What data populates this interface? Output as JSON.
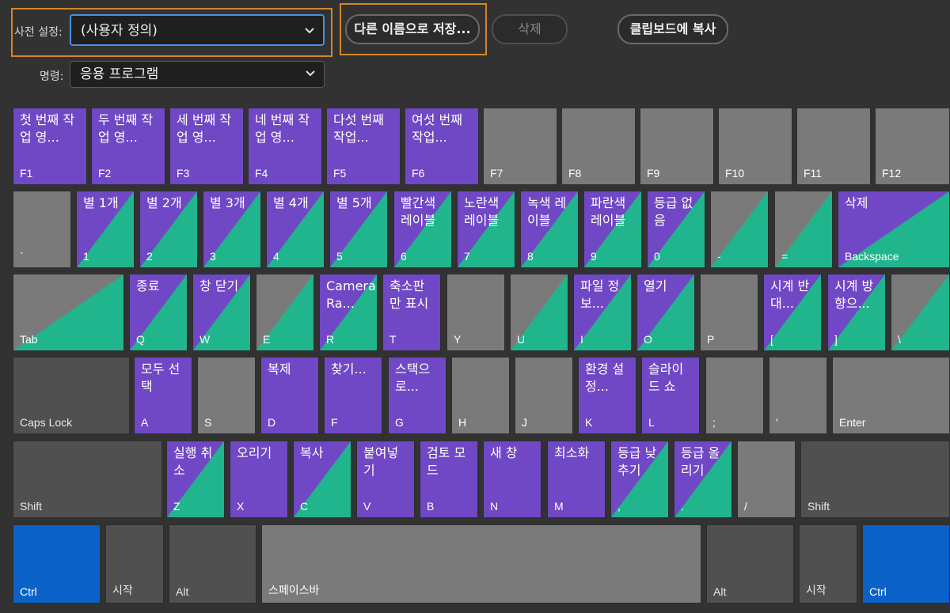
{
  "header": {
    "preset_label": "사전 설정:",
    "preset_value": "(사용자 정의)",
    "save_as_label": "다른 이름으로 저장...",
    "delete_label": "삭제",
    "copy_label": "클립보드에 복사",
    "command_label": "명령:",
    "command_value": "응용 프로그램"
  },
  "keyboard": {
    "f1": {
      "cmd": "첫 번째 작\n업 영...",
      "cap": "F1"
    },
    "f2": {
      "cmd": "두 번째 작\n업 영...",
      "cap": "F2"
    },
    "f3": {
      "cmd": "세 번째 작\n업 영...",
      "cap": "F3"
    },
    "f4": {
      "cmd": "네 번째 작\n업 영...",
      "cap": "F4"
    },
    "f5": {
      "cmd": "다섯 번째\n작업...",
      "cap": "F5"
    },
    "f6": {
      "cmd": "여섯 번째\n작업...",
      "cap": "F6"
    },
    "f7": {
      "cap": "F7"
    },
    "f8": {
      "cap": "F8"
    },
    "f9": {
      "cap": "F9"
    },
    "f10": {
      "cap": "F10"
    },
    "f11": {
      "cap": "F11"
    },
    "f12": {
      "cap": "F12"
    },
    "backtick": {
      "cap": "`"
    },
    "d1": {
      "cmd": "별 1개",
      "cap": "1"
    },
    "d2": {
      "cmd": "별 2개",
      "cap": "2"
    },
    "d3": {
      "cmd": "별 3개",
      "cap": "3"
    },
    "d4": {
      "cmd": "별 4개",
      "cap": "4"
    },
    "d5": {
      "cmd": "별 5개",
      "cap": "5"
    },
    "d6": {
      "cmd": "빨간색\n레이블",
      "cap": "6"
    },
    "d7": {
      "cmd": "노란색\n레이블",
      "cap": "7"
    },
    "d8": {
      "cmd": "녹색 레\n이블",
      "cap": "8"
    },
    "d9": {
      "cmd": "파란색\n레이블",
      "cap": "9"
    },
    "d0": {
      "cmd": "등급 없\n음",
      "cap": "0"
    },
    "minus": {
      "cap": "-"
    },
    "equals": {
      "cap": "="
    },
    "backspace": {
      "cmd": "삭제",
      "cap": "Backspace"
    },
    "tab": {
      "cap": "Tab"
    },
    "q": {
      "cmd": "종료",
      "cap": "Q"
    },
    "w": {
      "cmd": "창 닫기",
      "cap": "W"
    },
    "e": {
      "cap": "E"
    },
    "r": {
      "cmd": "Camera\nRa...",
      "cap": "R"
    },
    "t": {
      "cmd": "축소판\n만 표시",
      "cap": "T"
    },
    "y": {
      "cap": "Y"
    },
    "u": {
      "cap": "U"
    },
    "i": {
      "cmd": "파일 정\n보...",
      "cap": "I"
    },
    "o": {
      "cmd": "열기",
      "cap": "O"
    },
    "p": {
      "cap": "P"
    },
    "lbracket": {
      "cmd": "시계 반\n대...",
      "cap": "["
    },
    "rbracket": {
      "cmd": "시계 방\n향으...",
      "cap": "]"
    },
    "backslash": {
      "cap": "\\"
    },
    "capslock": {
      "cap": "Caps Lock"
    },
    "a": {
      "cmd": "모두 선\n택",
      "cap": "A"
    },
    "s": {
      "cap": "S"
    },
    "d": {
      "cmd": "복제",
      "cap": "D"
    },
    "f": {
      "cmd": "찾기...",
      "cap": "F"
    },
    "g": {
      "cmd": "스택으\n로...",
      "cap": "G"
    },
    "h": {
      "cap": "H"
    },
    "j": {
      "cap": "J"
    },
    "k": {
      "cmd": "환경 설\n정...",
      "cap": "K"
    },
    "l": {
      "cmd": "슬라이\n드 쇼",
      "cap": "L"
    },
    "semicolon": {
      "cap": ";"
    },
    "quote": {
      "cap": "'"
    },
    "enter": {
      "cap": "Enter"
    },
    "lshift": {
      "cap": "Shift"
    },
    "z": {
      "cmd": "실행 취\n소",
      "cap": "Z"
    },
    "x": {
      "cmd": "오리기",
      "cap": "X"
    },
    "c": {
      "cmd": "복사",
      "cap": "C"
    },
    "v": {
      "cmd": "붙여넣\n기",
      "cap": "V"
    },
    "b": {
      "cmd": "검토 모\n드",
      "cap": "B"
    },
    "n": {
      "cmd": "새 창",
      "cap": "N"
    },
    "m": {
      "cmd": "최소화",
      "cap": "M"
    },
    "comma": {
      "cmd": "등급 낮\n추기",
      "cap": ","
    },
    "period": {
      "cmd": "등급 올\n리기",
      "cap": "."
    },
    "slash": {
      "cap": "/"
    },
    "rshift": {
      "cap": "Shift"
    },
    "lctrl": {
      "cap": "Ctrl"
    },
    "lstart": {
      "cap": "시작"
    },
    "lalt": {
      "cap": "Alt"
    },
    "space": {
      "cap": "스페이스바"
    },
    "ralt": {
      "cap": "Alt"
    },
    "rstart": {
      "cap": "시작"
    },
    "rctrl": {
      "cap": "Ctrl"
    }
  },
  "colors": {
    "app_command": "#7048c5",
    "panel_command": "#20b58c",
    "unassigned": "#7a7a7a",
    "modifier": "#0a62c9",
    "focus": "#d0872a"
  }
}
